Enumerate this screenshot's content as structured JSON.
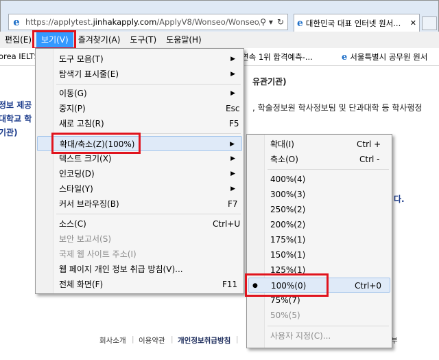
{
  "browser": {
    "url_host": "https://applytest.",
    "url_domain": "jinhakapply.com",
    "url_path": "/ApplyV8/Wonseo/Wonseo/...",
    "tab_title": "대한민국 대표 인터넷 원서...",
    "search_glyph": "⚲ ▾",
    "refresh_glyph": "↻",
    "close_glyph": "✕"
  },
  "menubar": {
    "items": [
      "편집(E)",
      "보기(V)",
      "즐겨찾기(A)",
      "도구(T)",
      "도움말(H)"
    ]
  },
  "favorites": [
    "orea IELTS",
    "연속 1위 합격예측-...",
    "서울특별시 공무원 원서"
  ],
  "page": {
    "heading_fragment": "유관기관)",
    "left_lines": [
      "정보 제공",
      "대학교 학",
      "기관)"
    ],
    "body_fragment": ", 학술정보원 학사정보팀 및 단과대학 등 학사행정",
    "notice_fragment": "다.",
    "footer": [
      "회사소개",
      "이용약관",
      "개인정보취급방침",
      "부"
    ]
  },
  "view_menu": {
    "items": [
      {
        "label": "도구 모음(T)",
        "shortcut": "",
        "submenu": true
      },
      {
        "label": "탐색기 표시줄(E)",
        "shortcut": "",
        "submenu": true
      },
      {
        "label": "이동(G)",
        "shortcut": "",
        "submenu": true
      },
      {
        "label": "중지(P)",
        "shortcut": "Esc",
        "submenu": false
      },
      {
        "label": "새로 고침(R)",
        "shortcut": "F5",
        "submenu": false
      },
      {
        "label": "확대/축소(Z)(100%)",
        "shortcut": "",
        "submenu": true
      },
      {
        "label": "텍스트 크기(X)",
        "shortcut": "",
        "submenu": true
      },
      {
        "label": "인코딩(D)",
        "shortcut": "",
        "submenu": true
      },
      {
        "label": "스타일(Y)",
        "shortcut": "",
        "submenu": true
      },
      {
        "label": "커서 브라우징(B)",
        "shortcut": "F7",
        "submenu": false
      },
      {
        "label": "소스(C)",
        "shortcut": "Ctrl+U",
        "submenu": false
      },
      {
        "label": "보안 보고서(S)",
        "shortcut": "",
        "submenu": false
      },
      {
        "label": "국제 웹 사이트 주소(I)",
        "shortcut": "",
        "submenu": false
      },
      {
        "label": "웹 페이지 개인 정보 취급 방침(V)...",
        "shortcut": "",
        "submenu": false
      },
      {
        "label": "전체 화면(F)",
        "shortcut": "F11",
        "submenu": false
      }
    ]
  },
  "zoom_menu": {
    "items": [
      {
        "label": "확대(I)",
        "shortcut": "Ctrl +"
      },
      {
        "label": "축소(O)",
        "shortcut": "Ctrl -"
      },
      {
        "label": "400%(4)",
        "shortcut": ""
      },
      {
        "label": "300%(3)",
        "shortcut": ""
      },
      {
        "label": "250%(2)",
        "shortcut": ""
      },
      {
        "label": "200%(2)",
        "shortcut": ""
      },
      {
        "label": "175%(1)",
        "shortcut": ""
      },
      {
        "label": "150%(1)",
        "shortcut": ""
      },
      {
        "label": "125%(1)",
        "shortcut": ""
      },
      {
        "label": "100%(0)",
        "shortcut": "Ctrl+0"
      },
      {
        "label": "75%(7)",
        "shortcut": ""
      },
      {
        "label": "50%(5)",
        "shortcut": ""
      },
      {
        "label": "사용자 지정(C)...",
        "shortcut": ""
      }
    ],
    "selected_bullet": "●"
  },
  "arrow_glyph": "▶",
  "colors": {
    "highlight_box": "#e0141e",
    "menu_active": "#3399ff"
  }
}
